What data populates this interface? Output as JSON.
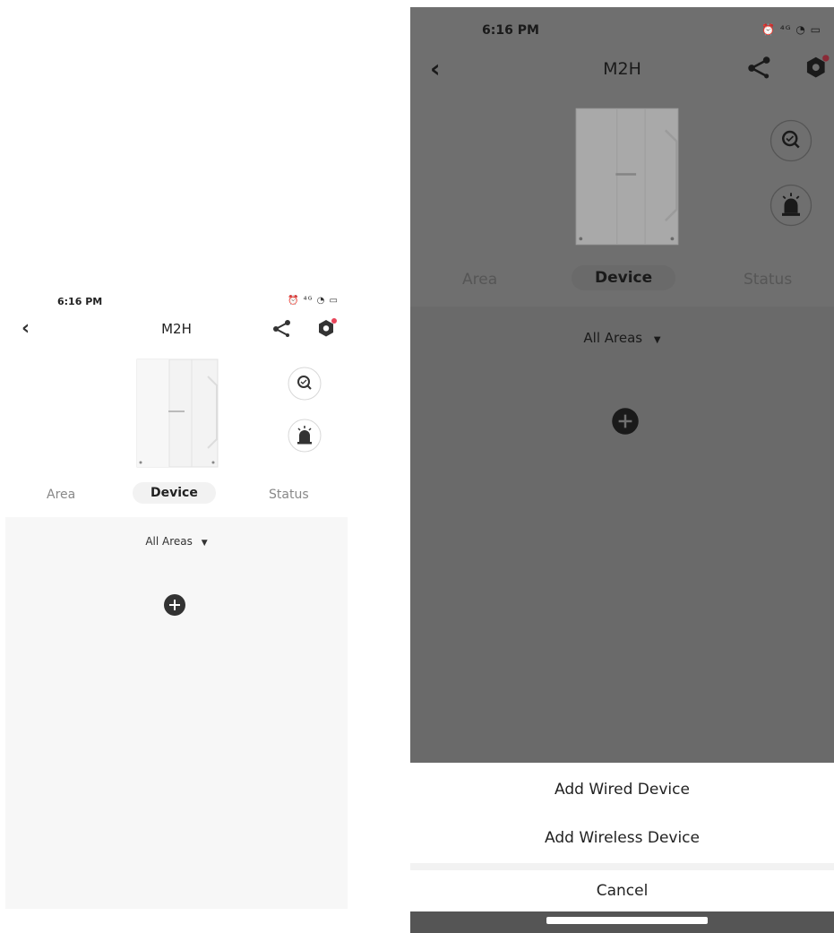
{
  "left": {
    "status": {
      "time": "6:16 PM",
      "icons": "⏰ ⁴ᴳ ◔ ▭"
    },
    "header": {
      "title": "M2H",
      "back_icon": "chevron-left-icon",
      "share_icon": "share-icon",
      "settings_icon": "hex-settings-icon"
    },
    "tabs": [
      {
        "label": "Area"
      },
      {
        "label": "Device"
      },
      {
        "label": "Status"
      }
    ],
    "filter": {
      "label": "All Areas"
    }
  },
  "right": {
    "status": {
      "time": "6:16 PM",
      "icons": "⏰ ⁴ᴳ ◔ ▭"
    },
    "header": {
      "title": "M2H"
    },
    "tabs": [
      {
        "label": "Area"
      },
      {
        "label": "Device"
      },
      {
        "label": "Status"
      }
    ],
    "filter": {
      "label": "All Areas"
    },
    "sheet": {
      "option1": "Add Wired Device",
      "option2": "Add Wireless Device",
      "cancel": "Cancel"
    }
  },
  "colors": {
    "overlay": "#6f6f6f",
    "accent_dot": "#e8455a",
    "sheet_bg": "#ffffff"
  }
}
